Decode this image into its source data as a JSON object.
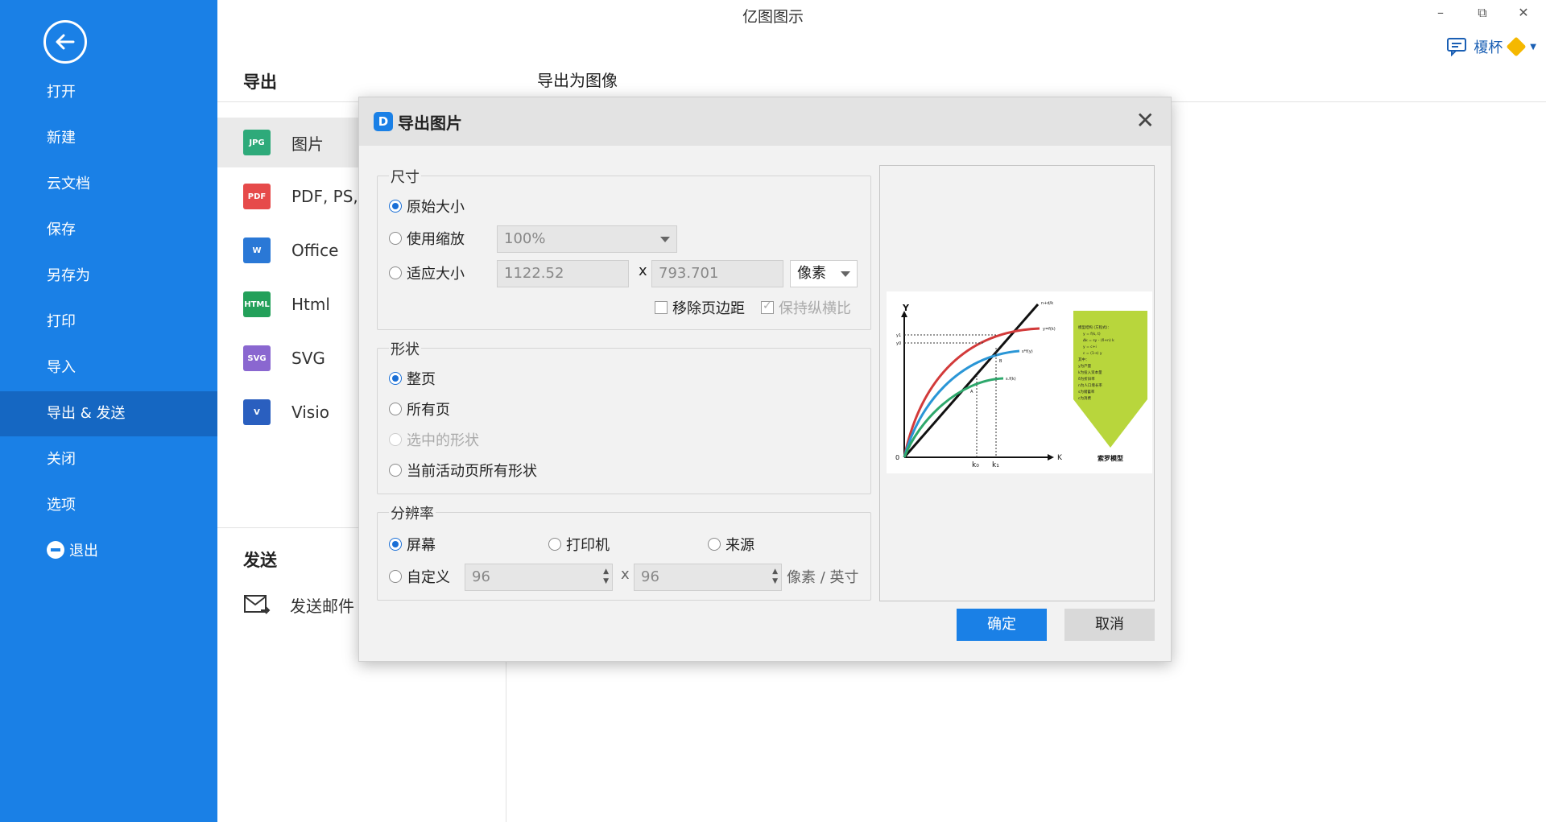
{
  "app_title": "亿图图示",
  "window_controls": {
    "minimize": "–",
    "restore": "⧉",
    "close": "✕"
  },
  "user": {
    "name": "榎杯"
  },
  "sidebar": {
    "items": [
      {
        "label": "打开"
      },
      {
        "label": "新建"
      },
      {
        "label": "云文档"
      },
      {
        "label": "保存"
      },
      {
        "label": "另存为"
      },
      {
        "label": "打印"
      },
      {
        "label": "导入"
      },
      {
        "label": "导出 & 发送",
        "active": true
      },
      {
        "label": "关闭"
      },
      {
        "label": "选项"
      },
      {
        "label": "退出"
      }
    ]
  },
  "main": {
    "export_title": "导出",
    "page_heading": "导出为图像",
    "export_items": [
      {
        "badge": "JPG",
        "label": "图片",
        "color": "#2eaa7a"
      },
      {
        "badge": "PDF",
        "label": "PDF, PS,",
        "color": "#e64a4a"
      },
      {
        "badge": "W",
        "label": "Office",
        "color": "#2a78d6"
      },
      {
        "badge": "HTML",
        "label": "Html",
        "color": "#23a05a"
      },
      {
        "badge": "SVG",
        "label": "SVG",
        "color": "#8a67d0"
      },
      {
        "badge": "V",
        "label": "Visio",
        "color": "#2a5fbf"
      }
    ],
    "send_title": "发送",
    "send_email": "发送邮件"
  },
  "dialog": {
    "title": "导出图片",
    "size": {
      "label": "尺寸",
      "original": "原始大小",
      "use_scale": "使用缩放",
      "scale_value": "100%",
      "fit_size": "适应大小",
      "width": "1122.52",
      "x": "x",
      "height": "793.701",
      "unit": "像素",
      "remove_margin": "移除页边距",
      "keep_ratio": "保持纵横比"
    },
    "shape": {
      "label": "形状",
      "whole_page": "整页",
      "all_pages": "所有页",
      "selected": "选中的形状",
      "active_page_shapes": "当前活动页所有形状"
    },
    "resolution": {
      "label": "分辨率",
      "screen": "屏幕",
      "printer": "打印机",
      "source": "来源",
      "custom": "自定义",
      "dpi_x": "96",
      "x": "x",
      "dpi_y": "96",
      "unit": "像素 / 英寸"
    },
    "preview": {
      "y_axis": "Y",
      "x_axis": "K",
      "origin": "0",
      "k0": "k₀",
      "k1": "k₁",
      "y1": "y1",
      "y0": "y0",
      "a": "A",
      "b": "B",
      "line_label": "n+d/k",
      "curve_top": "y=f(k)",
      "curve_mid": "s*f(y)",
      "curve_low": "s.f(k)",
      "note_title": "索罗模型",
      "note_lines": [
        "模型结构 (方程式)：",
        "y = f(k, t)",
        "Δk = sy - (δ+n) k",
        "y = c+i",
        "c = (1-s) y",
        "其中：",
        "y为产量",
        "k为投入资本量",
        "δ为折旧率",
        "n为人口增长率",
        "s为储蓄率",
        "c为消费"
      ]
    },
    "ok": "确定",
    "cancel": "取消"
  }
}
